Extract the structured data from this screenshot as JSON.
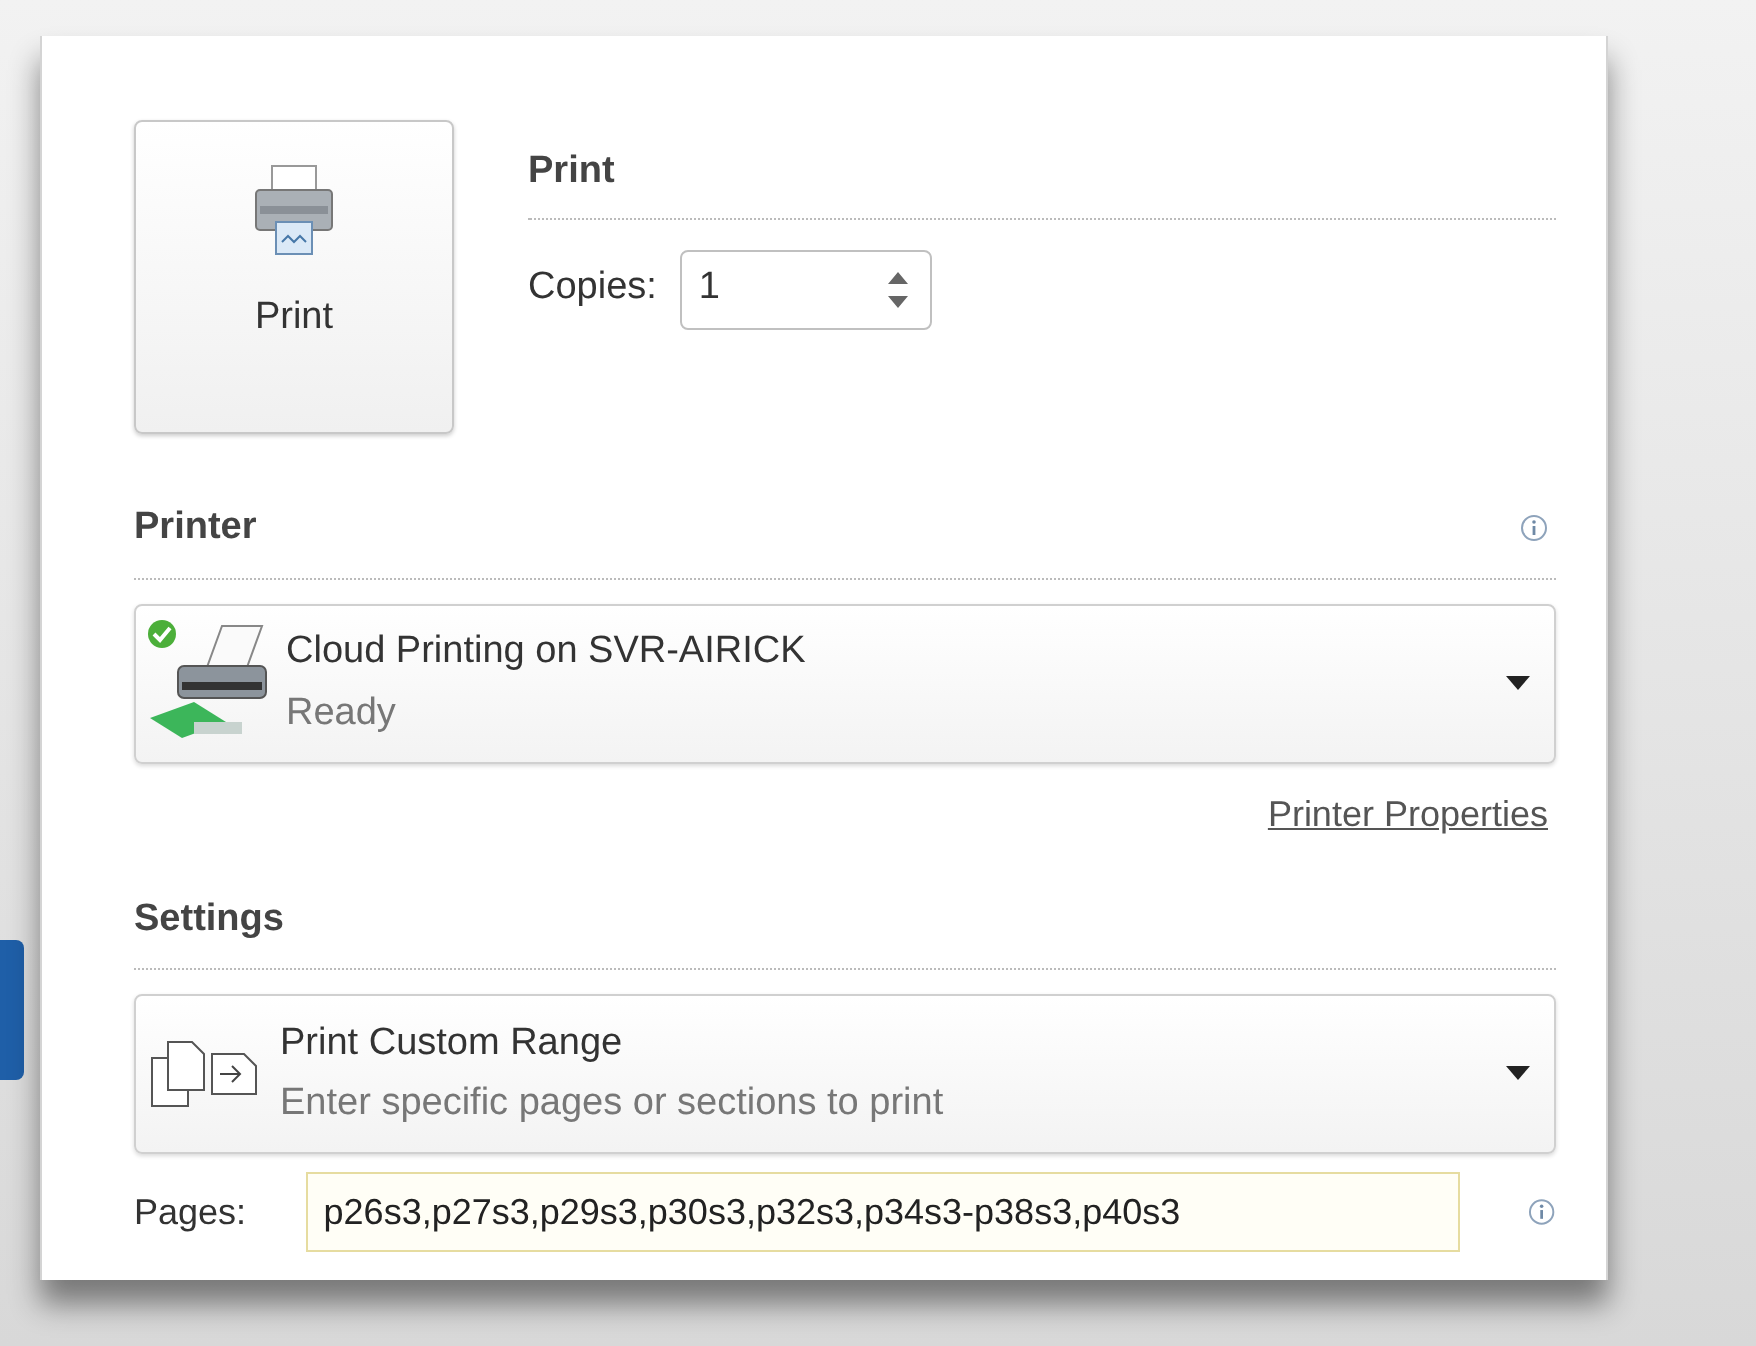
{
  "print_button": {
    "label": "Print"
  },
  "print_section": {
    "heading": "Print",
    "copies_label": "Copies:",
    "copies_value": "1"
  },
  "printer_section": {
    "heading": "Printer",
    "printer": {
      "name": "Cloud Printing on SVR-AIRICK",
      "status": "Ready"
    },
    "properties_link": "Printer Properties"
  },
  "settings_section": {
    "heading": "Settings",
    "range": {
      "title": "Print Custom Range",
      "description": "Enter specific pages or sections to print"
    },
    "pages_label": "Pages:",
    "pages_value": "p26s3,p27s3,p29s3,p30s3,p32s3,p34s3-p38s3,p40s3"
  }
}
